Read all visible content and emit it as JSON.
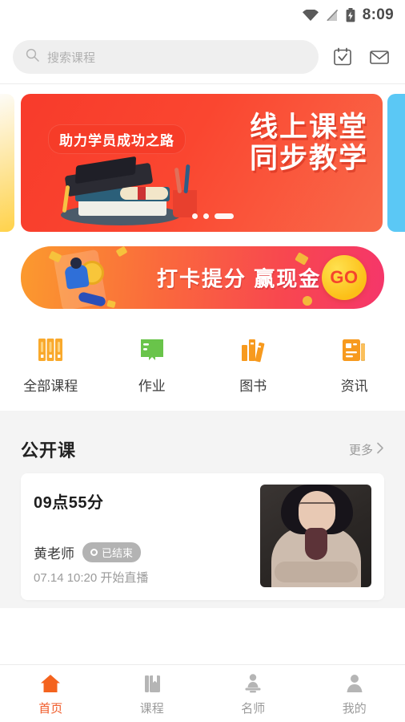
{
  "status_bar": {
    "time": "8:09",
    "icons": [
      "wifi-icon",
      "signal-off-icon",
      "battery-charging-icon"
    ]
  },
  "header": {
    "search": {
      "placeholder": "搜索课程",
      "icon": "search-icon"
    },
    "checkin_icon": "calendar-check-icon",
    "mail_icon": "mail-icon"
  },
  "carousel": {
    "badge": "助力学员成功之路",
    "headline_line1": "线上课堂",
    "headline_line2": "同步教学",
    "dots_total": 3,
    "dots_active_index": 2,
    "accent_color": "#f83b2b",
    "next_slide_color": "#5bc8f5"
  },
  "promo": {
    "text": "打卡提分 赢现金",
    "button_label": "GO",
    "gradient_from": "#fb9a2e",
    "gradient_to": "#f5366a"
  },
  "quick_links": [
    {
      "label": "全部课程",
      "icon": "binders-icon",
      "color": "#f7a62a"
    },
    {
      "label": "作业",
      "icon": "open-book-icon",
      "color": "#63c martin"
    },
    {
      "label": "图书",
      "icon": "books-icon",
      "color": "#f79a1e"
    },
    {
      "label": "资讯",
      "icon": "news-document-icon",
      "color": "#f79a1e"
    }
  ],
  "section": {
    "title": "公开课",
    "more_label": "更多",
    "more_icon": "chevron-right-icon"
  },
  "course_card": {
    "title": "09点55分",
    "teacher": "黄老师",
    "status": "已结束",
    "status_icon": "record-circle-icon",
    "time": "07.14 10:20 开始直播",
    "thumbnail": "teacher-photo"
  },
  "bottom_nav": {
    "active_index": 0,
    "active_color": "#f05a28",
    "items": [
      {
        "label": "首页",
        "icon": "home-icon"
      },
      {
        "label": "课程",
        "icon": "book-bookmark-icon"
      },
      {
        "label": "名师",
        "icon": "teacher-podium-icon"
      },
      {
        "label": "我的",
        "icon": "person-icon"
      }
    ]
  }
}
